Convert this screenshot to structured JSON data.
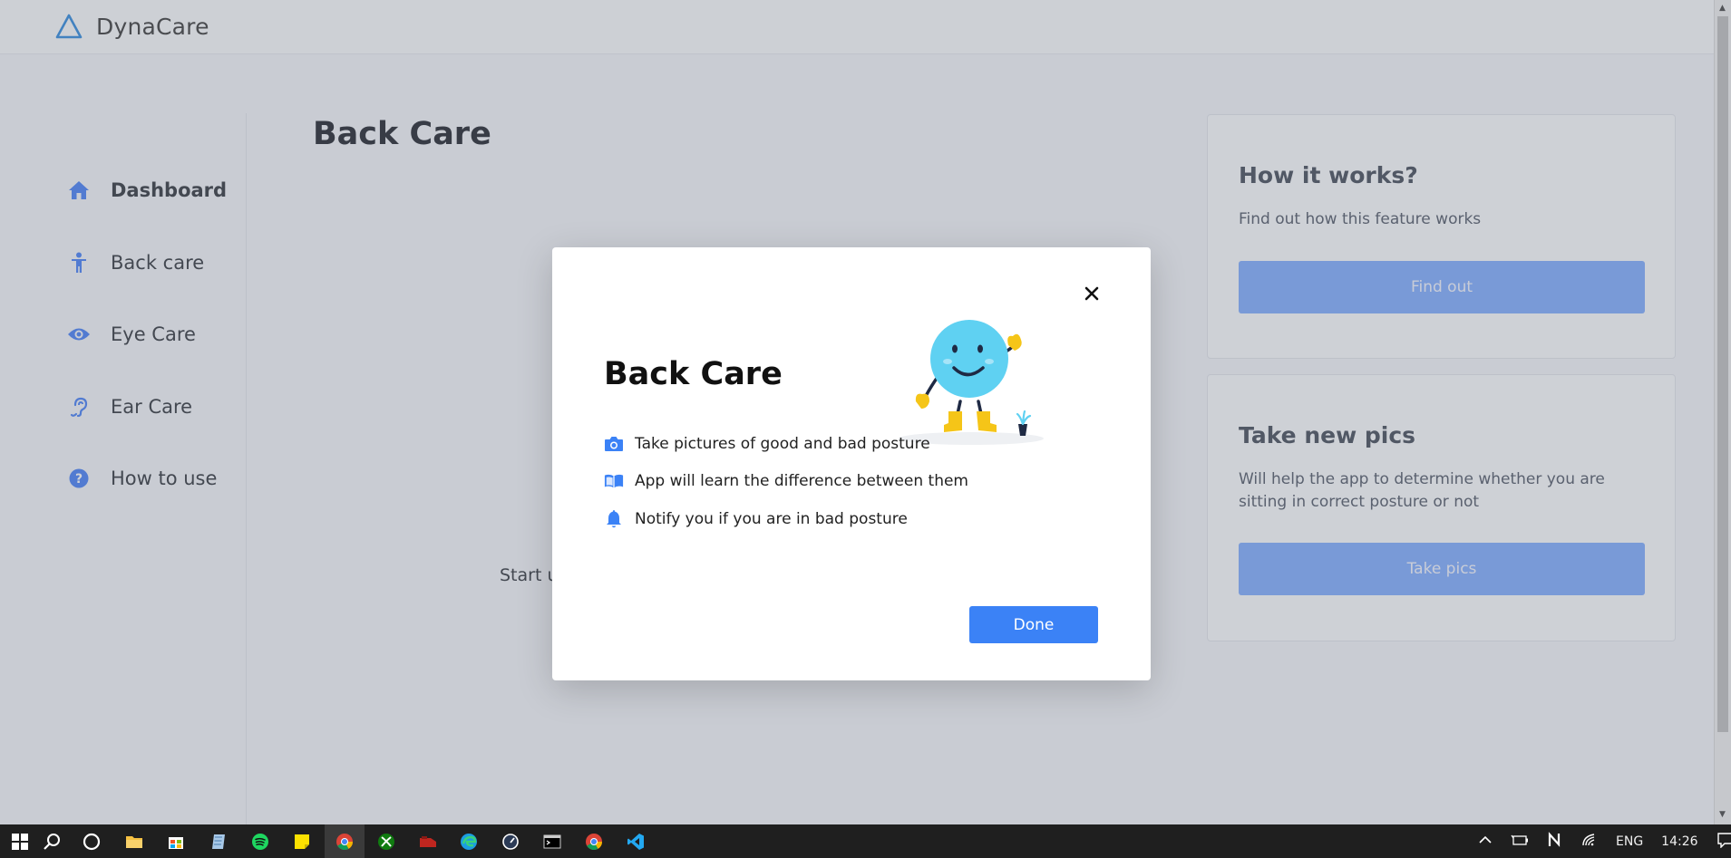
{
  "app": {
    "name": "DynaCare"
  },
  "sidebar": {
    "items": [
      {
        "label": "Dashboard",
        "icon": "home-icon",
        "active": true
      },
      {
        "label": "Back care",
        "icon": "person-icon",
        "active": false
      },
      {
        "label": "Eye Care",
        "icon": "eye-icon",
        "active": false
      },
      {
        "label": "Ear Care",
        "icon": "ear-icon",
        "active": false
      },
      {
        "label": "How to use",
        "icon": "question-icon",
        "active": false
      }
    ]
  },
  "main": {
    "title": "Back Care",
    "start_text": "Start u"
  },
  "cards": {
    "how_it_works": {
      "title": "How it works?",
      "text": "Find out how this feature works",
      "button": "Find out"
    },
    "take_pics": {
      "title": "Take new pics",
      "text": "Will help the app to determine whether you are sitting in correct posture or not",
      "button": "Take pics"
    }
  },
  "modal": {
    "title": "Back Care",
    "features": [
      {
        "icon": "camera-icon",
        "text": "Take pictures of good and bad posture"
      },
      {
        "icon": "book-icon",
        "text": "App will learn the difference between them"
      },
      {
        "icon": "bell-icon",
        "text": "Notify you if you are in bad posture"
      }
    ],
    "done_button": "Done",
    "close_icon": "close-icon"
  },
  "taskbar": {
    "apps": [
      "start-icon",
      "search-icon",
      "cortana-icon",
      "file-explorer-icon",
      "store-icon",
      "notepad-icon",
      "spotify-icon",
      "sticky-notes-icon",
      "chrome-icon",
      "xbox-icon",
      "app-icon",
      "edge-icon",
      "speedometer-icon",
      "terminal-icon",
      "chrome-icon",
      "vscode-icon"
    ],
    "language": "ENG",
    "time": "14:26"
  },
  "colors": {
    "accent": "#3b82f6",
    "accent_light": "#86b0ff",
    "icon_blue": "#4f86f7",
    "overlay": "rgba(90,96,110,0.28)"
  }
}
